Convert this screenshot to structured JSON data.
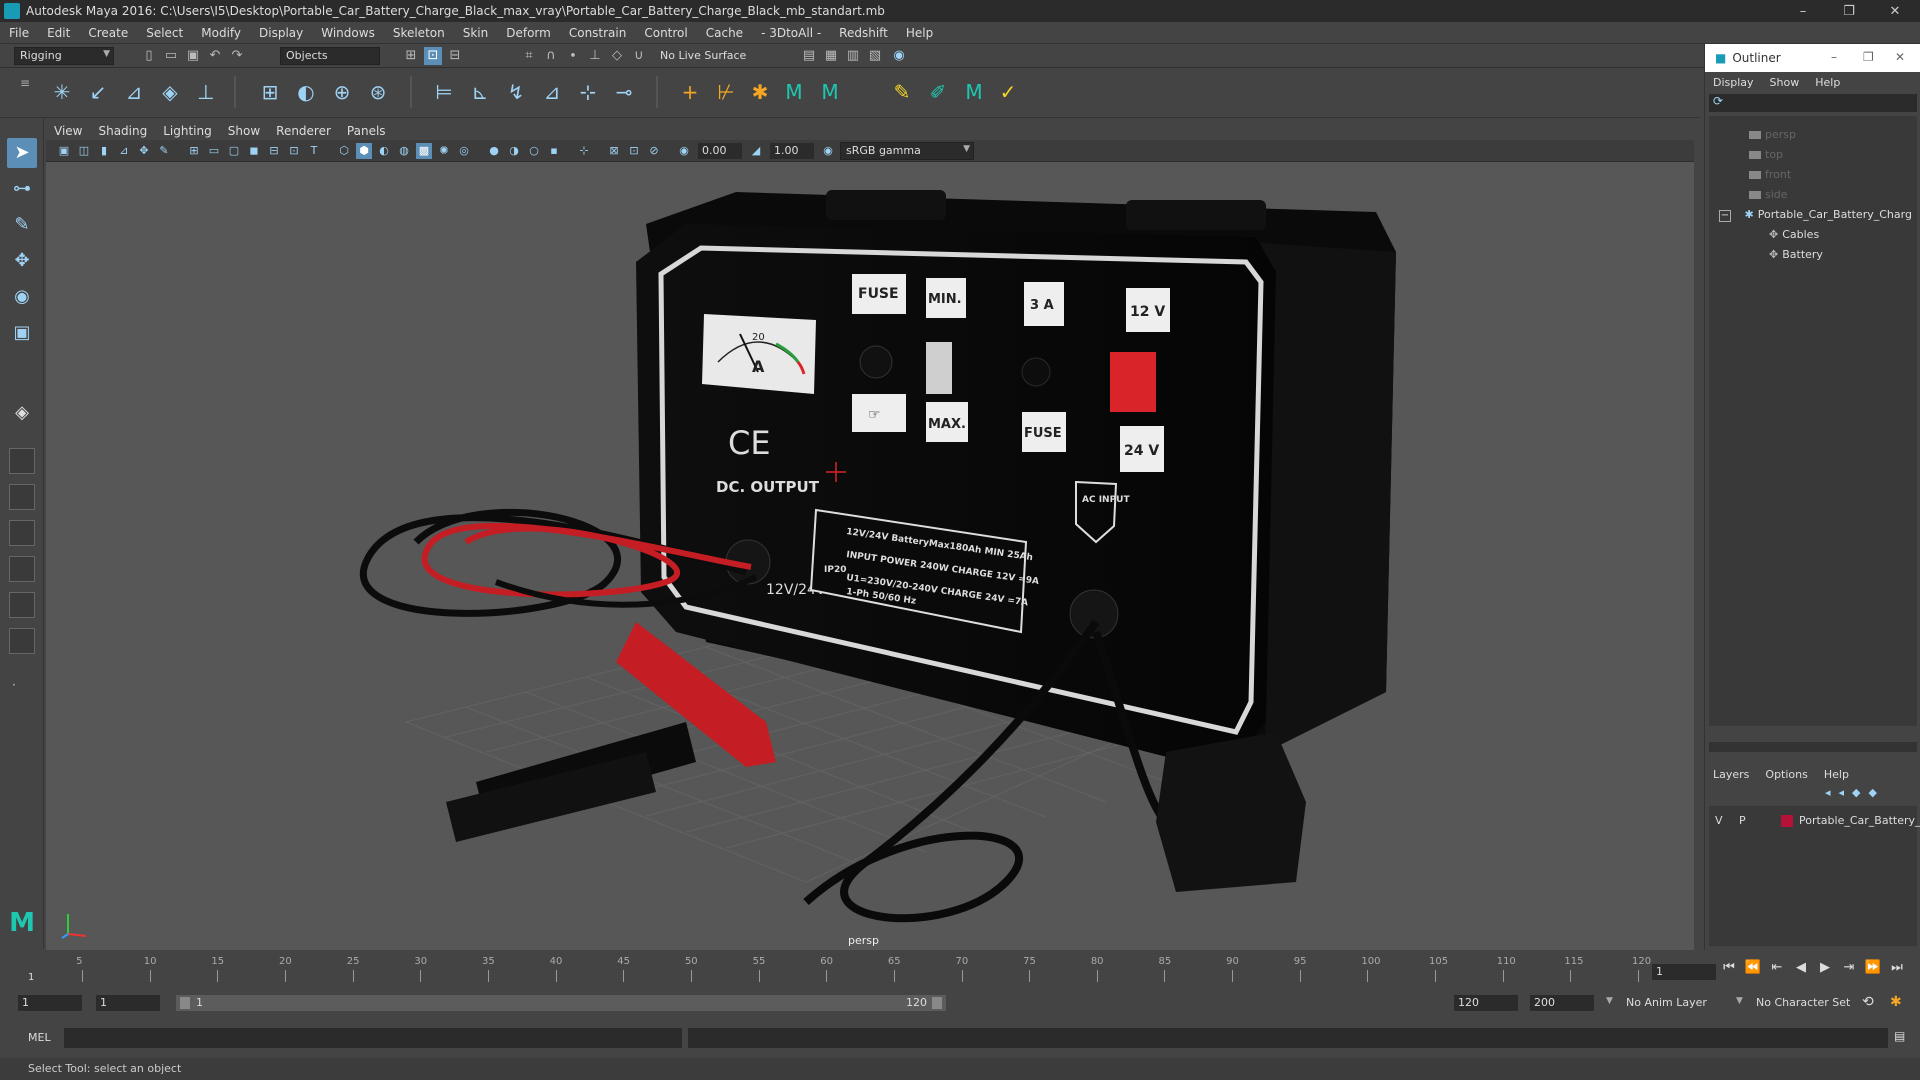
{
  "window": {
    "title": "Autodesk Maya 2016: C:\\Users\\I5\\Desktop\\Portable_Car_Battery_Charge_Black_max_vray\\Portable_Car_Battery_Charge_Black_mb_standart.mb",
    "minimize": "–",
    "maximize": "❐",
    "close": "✕"
  },
  "menubar": [
    "File",
    "Edit",
    "Create",
    "Select",
    "Modify",
    "Display",
    "Windows",
    "Skeleton",
    "Skin",
    "Deform",
    "Constrain",
    "Control",
    "Cache",
    "- 3DtoAll -",
    "Redshift",
    "Help"
  ],
  "statusline": {
    "mode": "Rigging",
    "selection_mask": "Objects",
    "live_surface": "No Live Surface"
  },
  "viewport": {
    "menu": [
      "View",
      "Shading",
      "Lighting",
      "Show",
      "Renderer",
      "Panels"
    ],
    "exposure": "0.00",
    "gamma": "1.00",
    "color_space": "sRGB gamma",
    "camera_label": "persp"
  },
  "model": {
    "fuse_label": "FUSE",
    "min_label": "MIN.",
    "amp_label": "3 A",
    "v12_label": "12 V",
    "max_label": "MAX.",
    "fuse2_label": "FUSE",
    "v24_label": "24 V",
    "ce_label": "CE",
    "dc_output": "DC. OUTPUT",
    "ac_input": "AC INPUT",
    "volt_label": "12V/24V",
    "gauge_scale": "20",
    "gauge_unit": "A",
    "spec_line1": "12V/24V   BatteryMax180Ah MIN 25Ah",
    "spec_line2": "INPUT POWER 240W   CHARGE 12V =9A",
    "spec_line3": "U1=230V/20-240V   CHARGE 24V =7A",
    "spec_line4": "1-Ph 50/60 Hz",
    "spec_ip": "IP20"
  },
  "outliner": {
    "title": "Outliner",
    "menu": [
      "Display",
      "Show",
      "Help"
    ],
    "items": [
      {
        "label": "persp"
      },
      {
        "label": "top"
      },
      {
        "label": "front"
      },
      {
        "label": "side"
      },
      {
        "label": "Portable_Car_Battery_Charg"
      },
      {
        "label": "Cables"
      },
      {
        "label": "Battery"
      }
    ],
    "expand_toggle": "−",
    "layers_menu": [
      "Layers",
      "Options",
      "Help"
    ],
    "layer": {
      "v": "V",
      "p": "P",
      "name": "Portable_Car_Battery_C",
      "color": "#b5123a"
    }
  },
  "timeline": {
    "ticks": [
      "5",
      "10",
      "15",
      "20",
      "25",
      "30",
      "35",
      "40",
      "45",
      "50",
      "55",
      "60",
      "65",
      "70",
      "75",
      "80",
      "85",
      "90",
      "95",
      "100",
      "105",
      "110",
      "115",
      "120"
    ],
    "start_label": "1",
    "current_frame": "1"
  },
  "range": {
    "start": "1",
    "playback_start": "1",
    "slider_start": "1",
    "slider_end": "120",
    "playback_end": "120",
    "end": "200",
    "anim_layer": "No Anim Layer",
    "character_set": "No Character Set"
  },
  "cmdline": {
    "lang": "MEL"
  },
  "helpline": {
    "text": "Select Tool: select an object"
  },
  "colors": {
    "accent": "#5b8fb8",
    "red": "#d9252a"
  }
}
